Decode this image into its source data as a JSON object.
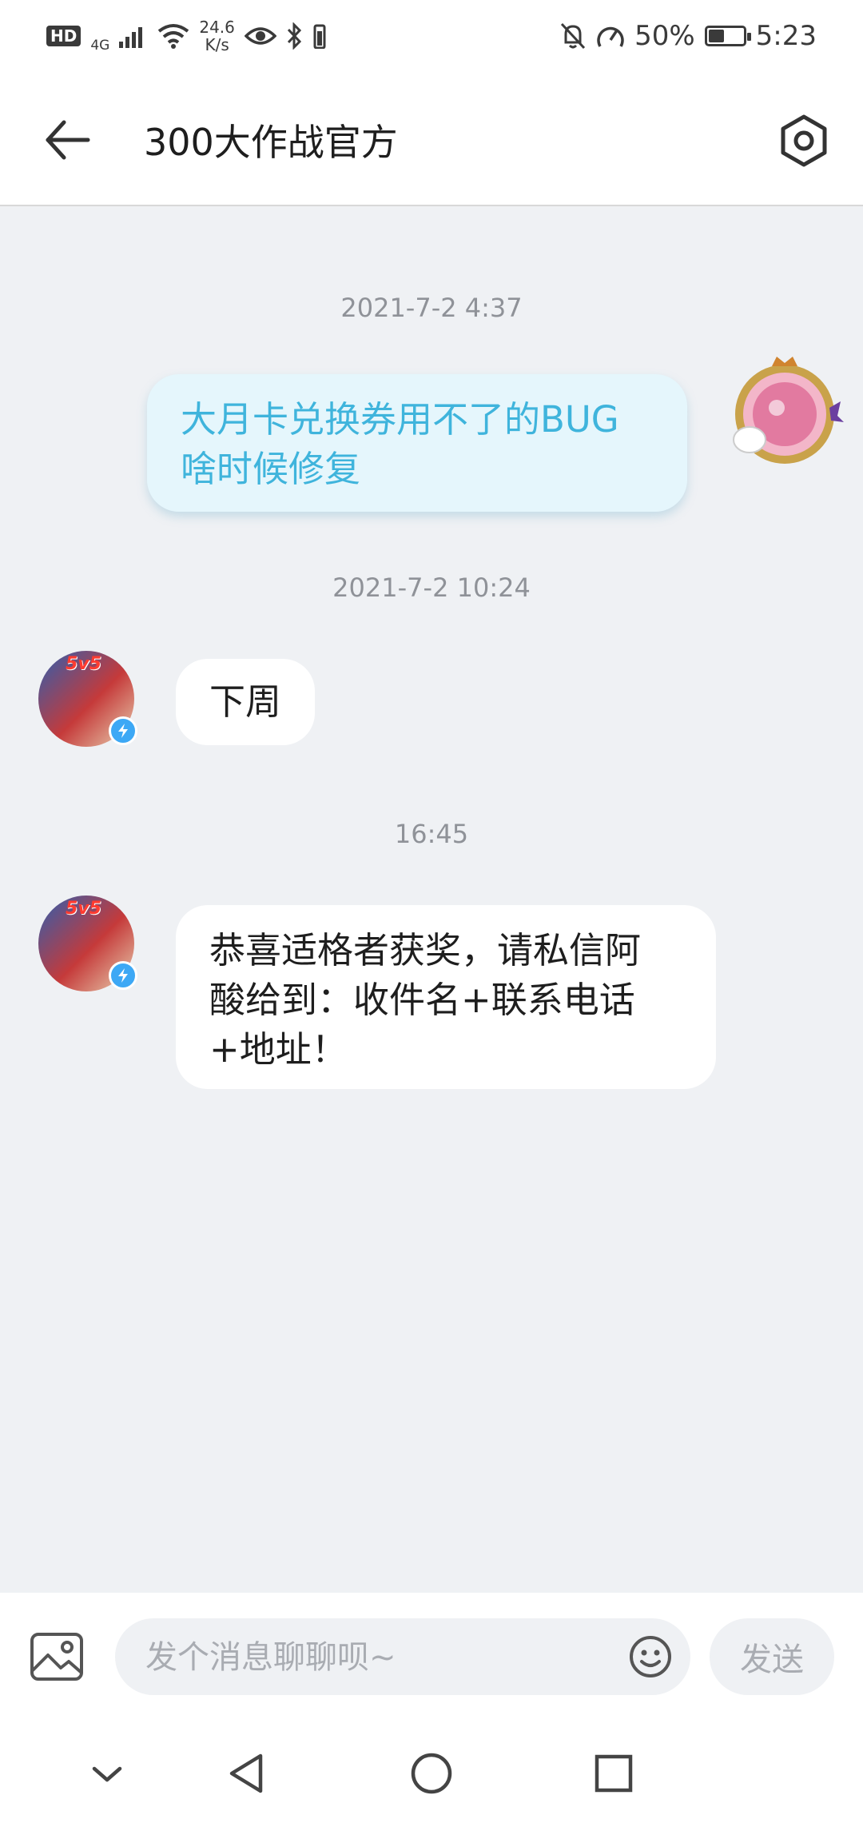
{
  "status_bar": {
    "hd": "HD",
    "network": "4G",
    "speed_value": "24.6",
    "speed_unit": "K/s",
    "battery_pct": "50%",
    "battery_level": 0.5,
    "time": "5:23"
  },
  "header": {
    "title": "300大作战官方"
  },
  "chat": {
    "timestamps": [
      "2021-7-2 4:37",
      "2021-7-2 10:24",
      "16:45"
    ],
    "messages": [
      {
        "sender": "me",
        "text_line1": "大月卡兑换券用不了的BUG",
        "text_line2": "啥时候修复"
      },
      {
        "sender": "official",
        "text": "下周"
      },
      {
        "sender": "official",
        "text_line1": "恭喜适格者获奖，请私信阿",
        "text_line2": "酸给到：收件名+联系电话",
        "text_line3": "+地址！"
      }
    ],
    "official_avatar_label": "5v5"
  },
  "input_bar": {
    "placeholder": "发个消息聊聊呗~",
    "send_label": "发送"
  },
  "colors": {
    "background": "#eff1f4",
    "outgoing_bubble": "#e5f6fc",
    "outgoing_text": "#3fb4dc",
    "incoming_bubble": "#ffffff",
    "verify_badge": "#3da8f5"
  }
}
